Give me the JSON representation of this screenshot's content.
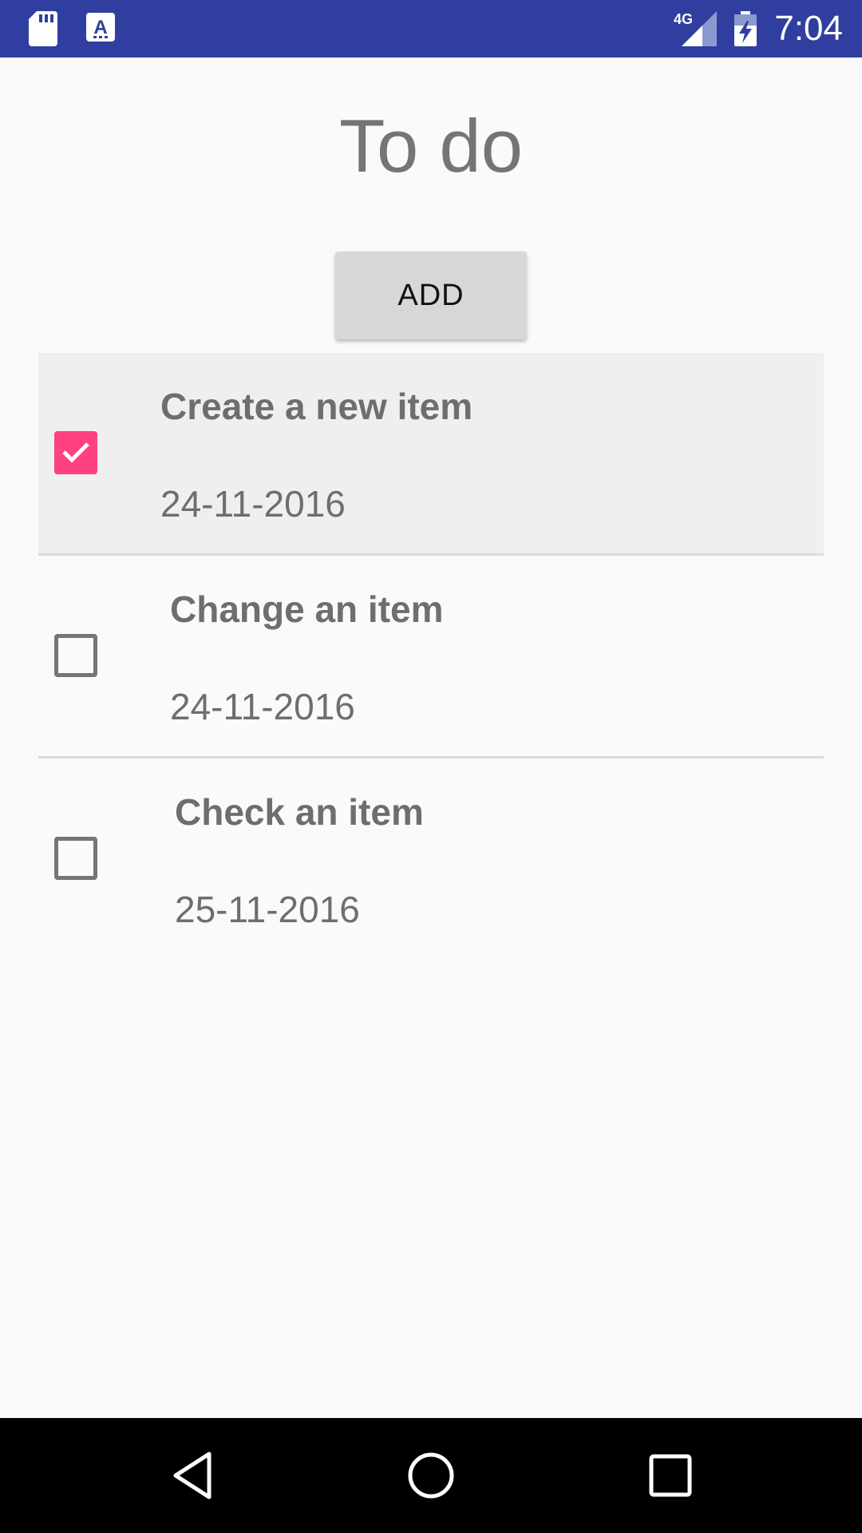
{
  "status_bar": {
    "time": "7:04",
    "network_label": "4G",
    "background_color": "#303f9f",
    "icons": [
      "sd-card-icon",
      "keyboard-a-icon",
      "signal-4g-icon",
      "battery-charging-icon"
    ]
  },
  "page": {
    "title": "To do",
    "add_button_label": "ADD"
  },
  "todo_items": [
    {
      "title": "Create a new item",
      "date": "24-11-2016",
      "checked": true
    },
    {
      "title": "Change an item",
      "date": "24-11-2016",
      "checked": false
    },
    {
      "title": "Check an item",
      "date": "25-11-2016",
      "checked": false
    }
  ],
  "colors": {
    "accent": "#ff4081",
    "text_gray": "#6e6e6e",
    "button_bg": "#d6d7d7"
  },
  "nav_bar": {
    "icons": [
      "back-icon",
      "home-icon",
      "recents-icon"
    ]
  }
}
